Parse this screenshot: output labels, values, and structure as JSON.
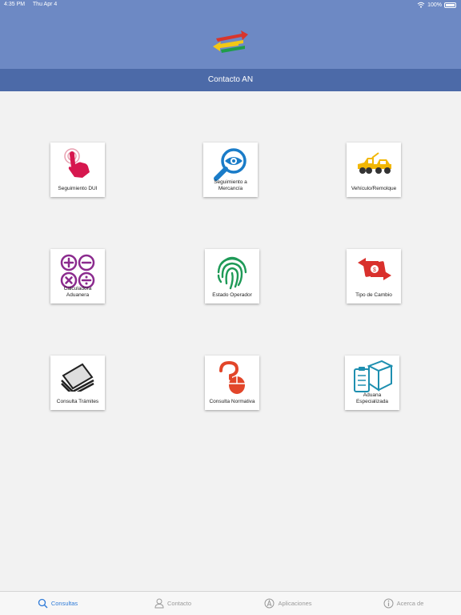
{
  "status": {
    "time": "4:35 PM",
    "date": "Thu Apr 4",
    "battery": "100%"
  },
  "header": {
    "title": "Contacto AN"
  },
  "tiles": [
    {
      "label": "Seguimiento DUI",
      "icon": "hand-pointer-icon"
    },
    {
      "label": "Seguimiento a Mercancía",
      "icon": "magnifier-eye-icon"
    },
    {
      "label": "Vehículo/Remolque",
      "icon": "tow-truck-icon"
    },
    {
      "label": "Calculadora Aduanera",
      "icon": "calculator-operators-icon"
    },
    {
      "label": "Estado Operador",
      "icon": "fingerprint-icon"
    },
    {
      "label": "Tipo de Cambio",
      "icon": "currency-exchange-icon"
    },
    {
      "label": "Consulta Trámites",
      "icon": "documents-stack-icon"
    },
    {
      "label": "Consulta Normativa",
      "icon": "question-mouse-icon"
    },
    {
      "label": "Aduana Especializada",
      "icon": "box-clipboard-icon"
    }
  ],
  "tabs": [
    {
      "label": "Consultas",
      "icon": "search-icon",
      "active": true
    },
    {
      "label": "Contacto",
      "icon": "person-icon",
      "active": false
    },
    {
      "label": "Aplicaciones",
      "icon": "app-store-icon",
      "active": false
    },
    {
      "label": "Acerca de",
      "icon": "info-icon",
      "active": false
    }
  ],
  "colors": {
    "header": "#6d89c4",
    "navbar": "#4c6aa8",
    "active_tab": "#2f7bd8"
  }
}
